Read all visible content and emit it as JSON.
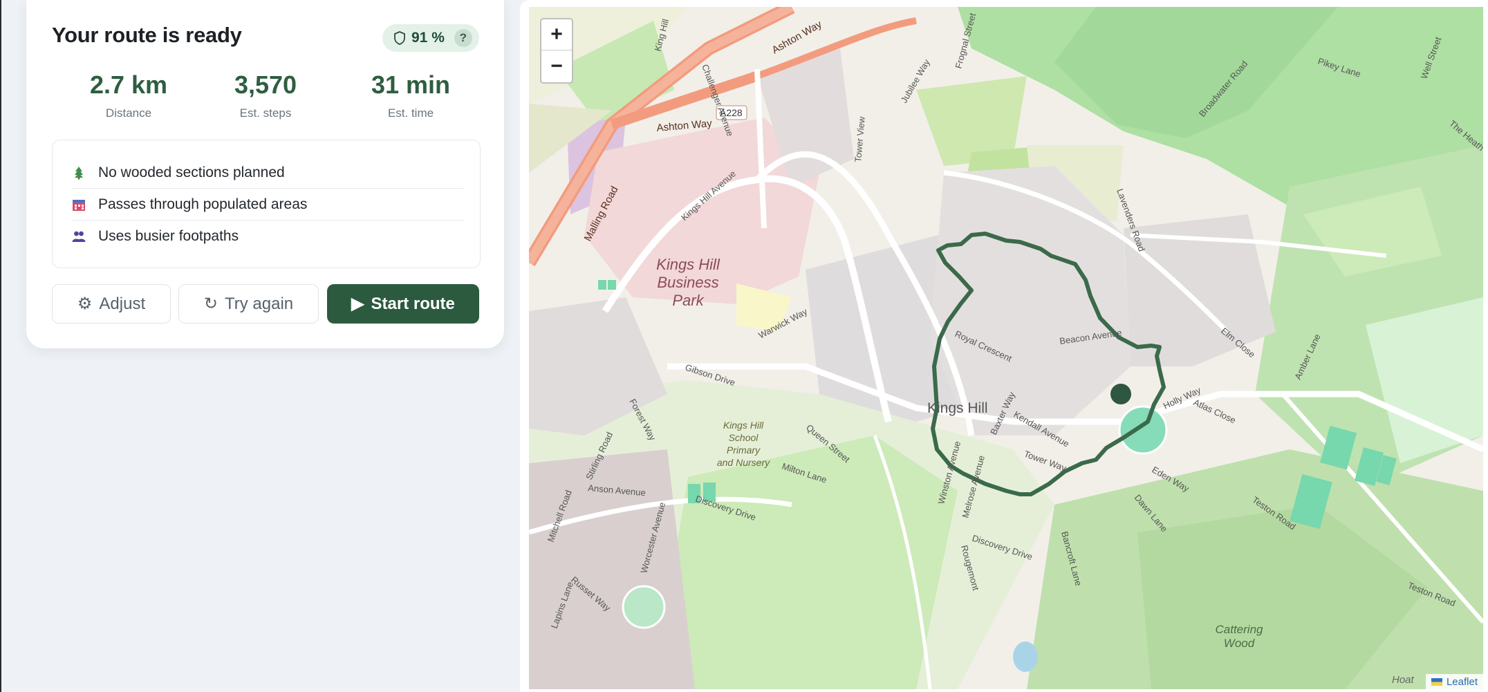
{
  "route": {
    "title": "Your route is ready",
    "safety_score": "91 %",
    "help_label": "?",
    "stats": [
      {
        "value": "2.7 km",
        "label": "Distance"
      },
      {
        "value": "3,570",
        "label": "Est. steps"
      },
      {
        "value": "31 min",
        "label": "Est. time"
      }
    ],
    "notes": [
      {
        "text": "No wooded sections planned",
        "icon": "tree-icon"
      },
      {
        "text": "Passes through populated areas",
        "icon": "buildings-icon"
      },
      {
        "text": "Uses busier footpaths",
        "icon": "people-icon"
      }
    ],
    "buttons": {
      "adjust": "Adjust",
      "adjust_icon": "⚙",
      "try_again": "Try again",
      "try_again_icon": "↻",
      "start": "Start route",
      "start_icon": "▶"
    }
  },
  "map": {
    "zoom_in": "+",
    "zoom_out": "−",
    "attribution": "Leaflet",
    "labels": {
      "kings_hill": "Kings Hill",
      "business_park_1": "Kings Hill",
      "business_park_2": "Business",
      "business_park_3": "Park",
      "school_1": "Kings Hill",
      "school_2": "School",
      "school_3": "Primary",
      "school_4": "and Nursery",
      "cattering_1": "Cattering",
      "cattering_2": "Wood",
      "ashton_way": "Ashton Way",
      "ashton_way_2": "Ashton Way",
      "a228": "A228",
      "malling_road": "Malling Road",
      "kings_hill_avenue": "Kings Hill Avenue",
      "tower_view": "Tower View",
      "gibson_drive": "Gibson Drive",
      "forest_way": "Forest Way",
      "discovery_drive": "Discovery Drive",
      "discovery_drive_2": "Discovery Drive",
      "anson_avenue": "Anson Avenue",
      "royal_crescent": "Royal Crescent",
      "beacon_avenue": "Beacon Avenue",
      "teston_road": "Teston Road",
      "teston_road_2": "Teston Road",
      "pikey_lane": "Pikey Lane",
      "broadwater_road": "Broadwater Road",
      "lavenders_road": "Lavenders Road",
      "warwick_way": "Warwick Way",
      "milton_lane": "Milton Lane",
      "queen_street": "Queen Street",
      "kendall_avenue": "Kendall Avenue",
      "holly_way": "Holly Way",
      "eden_way": "Eden Way",
      "dawn_lane": "Dawn Lane",
      "bancroft_lane": "Bancroft Lane",
      "rougemont": "Rougemont",
      "worcester_avenue": "Worcester Avenue",
      "mitchell_road": "Mitchell Road",
      "stirling_road": "Stirling Road",
      "russet_way": "Russet Way",
      "lapins_lane": "Lapins Lane",
      "frognal_street": "Frognal Street",
      "jubilee_way": "Jubilee Way",
      "elm_close": "Elm Close",
      "atlas_close": "Atlas Close",
      "amber_lane": "Amber Lane",
      "the_heath": "The Heath",
      "well_street": "Well Street",
      "challenger_avenue": "Challenger Avenue",
      "king_hill": "King Hill",
      "teston_road_3": "Teston Road",
      "tower_way": "Tower Way",
      "winston_avenue": "Winston Avenue",
      "melrose_avenue": "Melrose Avenue",
      "baxter_way": "Baxter Way",
      "hoath": "Hoat"
    }
  },
  "colors": {
    "accent": "#2c5a3e",
    "route_line": "#3b6a4b",
    "pill_bg": "#e3f1e8"
  }
}
